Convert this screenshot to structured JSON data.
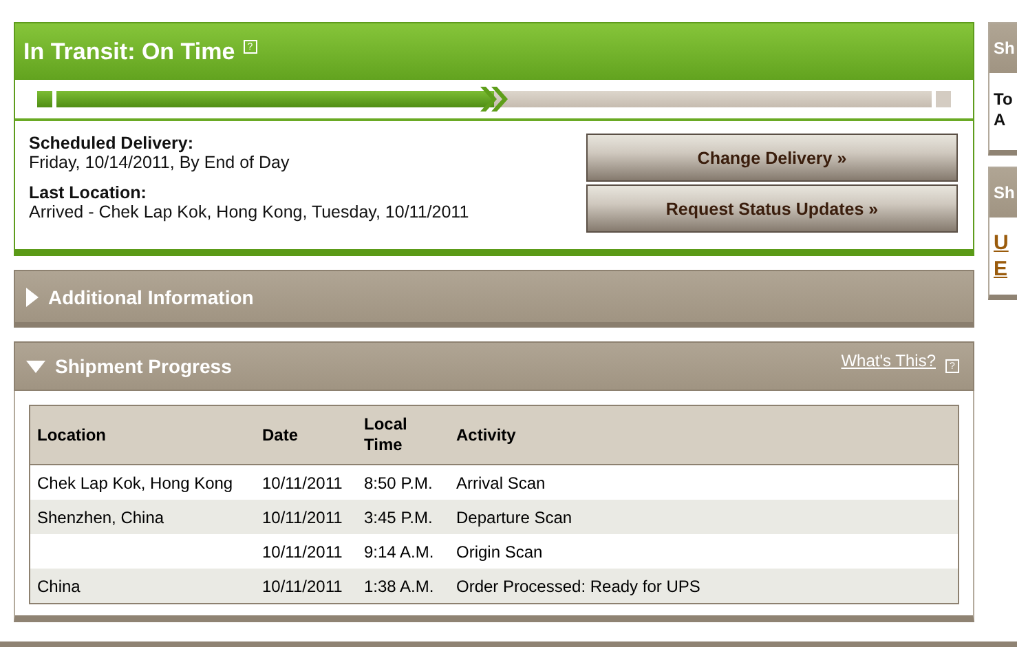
{
  "status": {
    "title": "In Transit: On Time",
    "help": "?",
    "progress": {
      "level": 0.5
    },
    "scheduled_label": "Scheduled Delivery:",
    "scheduled_value": "Friday, 10/14/2011, By End of Day",
    "last_label": "Last Location:",
    "last_value": "Arrived - Chek Lap Kok, Hong Kong, Tuesday, 10/11/2011",
    "buttons": [
      "Change Delivery »",
      "Request Status Updates »"
    ]
  },
  "sections": [
    {
      "title": "Additional Information",
      "expanded": false
    },
    {
      "title": "Shipment Progress",
      "expanded": true,
      "link": "What's This?",
      "help": "?"
    }
  ],
  "table": {
    "columns": [
      "Location",
      "Date",
      "Local Time",
      "Activity"
    ],
    "rows": [
      [
        "Chek Lap Kok, Hong Kong",
        "10/11/2011",
        "8:50 P.M.",
        "Arrival Scan"
      ],
      [
        "Shenzhen, China",
        "10/11/2011",
        "3:45 P.M.",
        "Departure Scan"
      ],
      [
        "",
        "10/11/2011",
        "9:14 A.M.",
        "Origin Scan"
      ],
      [
        "China",
        "10/11/2011",
        "1:38 A.M.",
        "Order Processed: Ready for UPS"
      ]
    ]
  },
  "sidebar": [
    {
      "title": "Sh",
      "lines": [
        "To",
        "A"
      ],
      "kind": "text"
    },
    {
      "title": "Sh",
      "lines": [
        "U",
        "E"
      ],
      "kind": "links"
    }
  ]
}
